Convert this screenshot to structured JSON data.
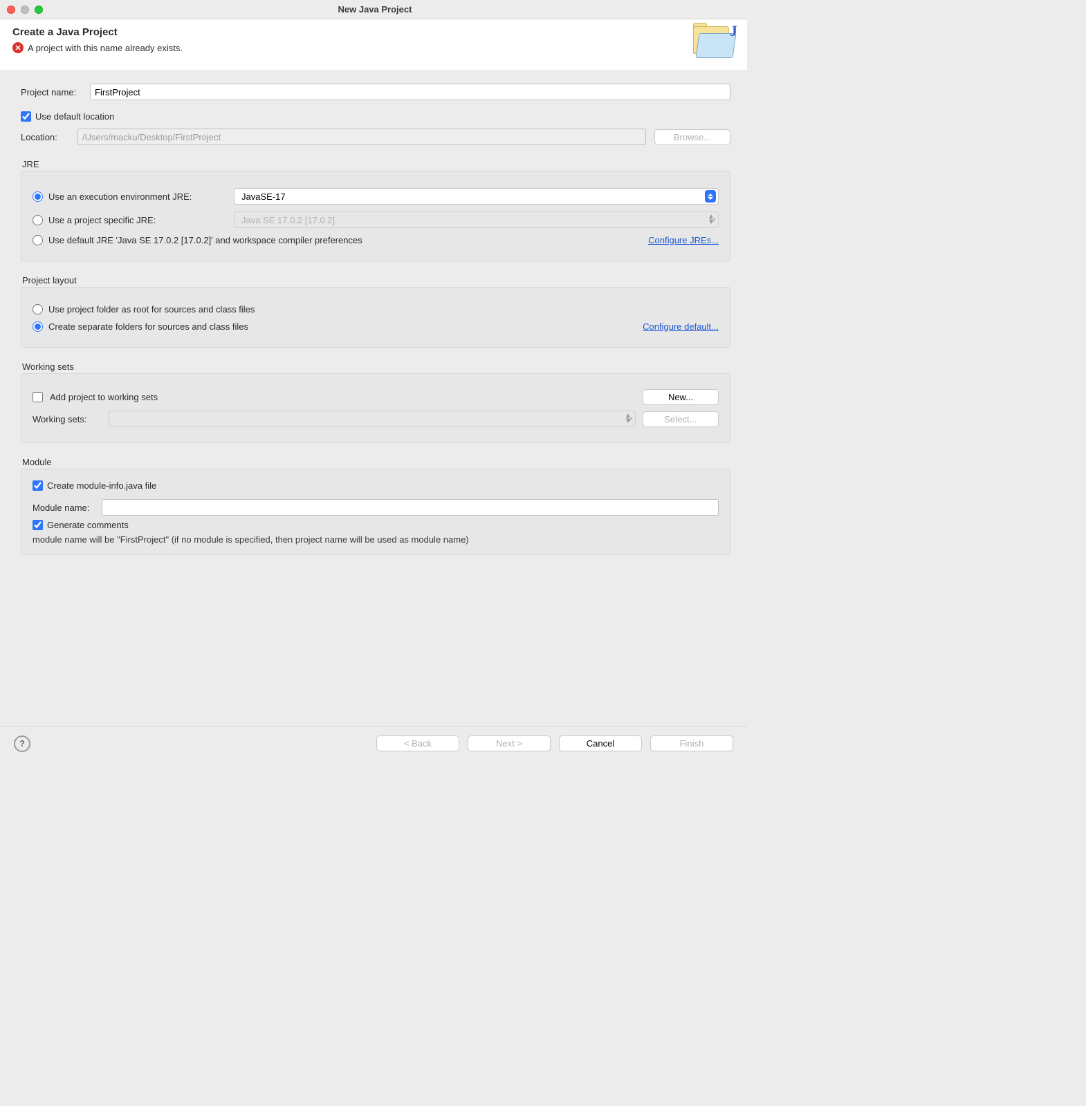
{
  "window": {
    "title": "New Java Project"
  },
  "header": {
    "title": "Create a Java Project",
    "error": "A project with this name already exists."
  },
  "projectName": {
    "label": "Project name:",
    "value": "FirstProject"
  },
  "defaultLocation": {
    "label": "Use default location"
  },
  "location": {
    "label": "Location:",
    "value": "/Users/macku/Desktop/FirstProject",
    "browse": "Browse..."
  },
  "jre": {
    "legend": "JRE",
    "opt1": "Use an execution environment JRE:",
    "opt1Value": "JavaSE-17",
    "opt2": "Use a project specific JRE:",
    "opt2Value": "Java SE 17.0.2 [17.0.2]",
    "opt3": "Use default JRE 'Java SE 17.0.2 [17.0.2]' and workspace compiler preferences",
    "configure": "Configure JREs..."
  },
  "layout": {
    "legend": "Project layout",
    "opt1": "Use project folder as root for sources and class files",
    "opt2": "Create separate folders for sources and class files",
    "configure": "Configure default..."
  },
  "ws": {
    "legend": "Working sets",
    "add": "Add project to working sets",
    "new": "New...",
    "label": "Working sets:",
    "select": "Select..."
  },
  "module": {
    "legend": "Module",
    "create": "Create module-info.java file",
    "nameLabel": "Module name:",
    "nameValue": "",
    "gen": "Generate comments",
    "hint": "module name will be \"FirstProject\"   (if no module is specified, then project name will be used as module name)"
  },
  "footer": {
    "back": "< Back",
    "next": "Next >",
    "cancel": "Cancel",
    "finish": "Finish"
  }
}
